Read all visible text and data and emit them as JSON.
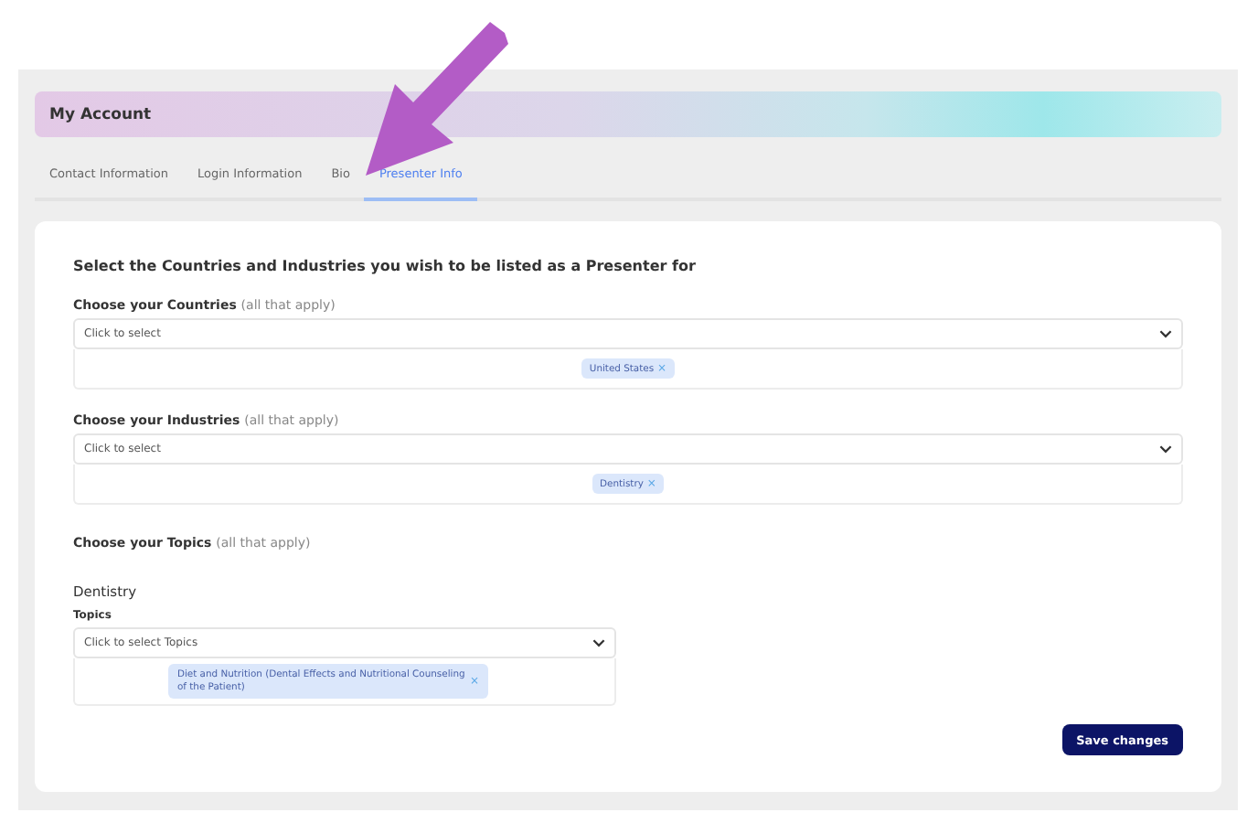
{
  "header": {
    "title": "My Account"
  },
  "tabs": [
    {
      "label": "Contact Information",
      "selected": false
    },
    {
      "label": "Login Information",
      "selected": false
    },
    {
      "label": "Bio",
      "selected": false
    },
    {
      "label": "Presenter Info",
      "selected": true
    }
  ],
  "heading": "Select the Countries and Industries you wish to be listed as a Presenter for",
  "sections": [
    {
      "label": "Choose your Countries",
      "hint": "(all that apply)",
      "placeholder": "Click to select",
      "chips": [
        {
          "text": "United States",
          "remove": "×"
        }
      ]
    },
    {
      "label": "Choose your Industries",
      "hint": "(all that apply)",
      "placeholder": "Click to select",
      "chips": [
        {
          "text": "Dentistry",
          "remove": "×"
        }
      ]
    }
  ],
  "topics": {
    "label": "Choose your Topics",
    "hint": "(all that apply)",
    "groups": [
      {
        "title": "Dentistry",
        "field_label": "Topics",
        "placeholder": "Click to select Topics",
        "chips": [
          {
            "text": "Diet and Nutrition (Dental Effects and Nutritional Counseling of the Patient)",
            "remove": "×"
          }
        ]
      }
    ]
  },
  "save_button": "Save changes"
}
